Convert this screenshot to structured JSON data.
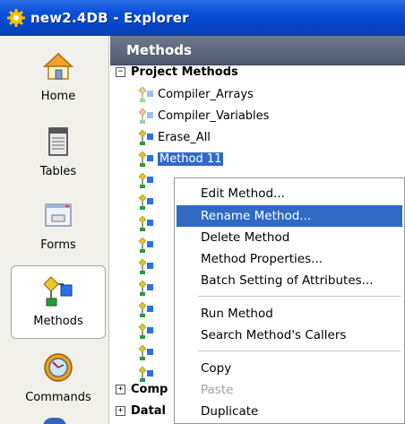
{
  "window": {
    "title": "new2.4DB - Explorer"
  },
  "sidebar": {
    "items": [
      {
        "label": "Home",
        "icon": "home-icon"
      },
      {
        "label": "Tables",
        "icon": "tables-icon"
      },
      {
        "label": "Forms",
        "icon": "forms-icon"
      },
      {
        "label": "Methods",
        "icon": "methods-icon",
        "active": true
      },
      {
        "label": "Commands",
        "icon": "commands-icon"
      }
    ]
  },
  "panel": {
    "title": "Methods",
    "tree": {
      "group": "Project Methods",
      "expander": "−",
      "methods": [
        "Compiler_Arrays",
        "Compiler_Variables",
        "Erase_All",
        "Method 11"
      ],
      "bottom_groups": [
        {
          "label": "Comp",
          "expander": "+"
        },
        {
          "label": "Datal",
          "expander": "+"
        }
      ]
    }
  },
  "context_menu": {
    "items": [
      {
        "label": "Edit Method...",
        "highlighted": false,
        "disabled": false
      },
      {
        "label": "Rename Method...",
        "highlighted": true,
        "disabled": false
      },
      {
        "label": "Delete Method",
        "highlighted": false,
        "disabled": false
      },
      {
        "label": "Method Properties...",
        "highlighted": false,
        "disabled": false
      },
      {
        "label": "Batch Setting of Attributes...",
        "highlighted": false,
        "disabled": false
      },
      {
        "label": "Run Method",
        "highlighted": false,
        "disabled": false
      },
      {
        "label": "Search Method's Callers",
        "highlighted": false,
        "disabled": false
      },
      {
        "label": "Copy",
        "highlighted": false,
        "disabled": false
      },
      {
        "label": "Paste",
        "highlighted": false,
        "disabled": true
      },
      {
        "label": "Duplicate",
        "highlighted": false,
        "disabled": false
      }
    ]
  },
  "colors": {
    "titlebar": "#0446c8",
    "selection": "#316ac5",
    "panel_header": "#5a657a"
  }
}
